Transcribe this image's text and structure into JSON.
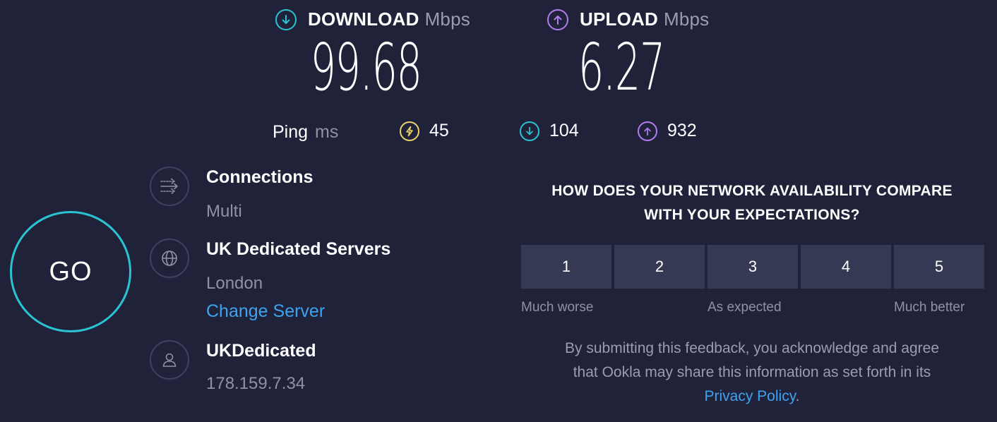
{
  "download": {
    "label": "DOWNLOAD",
    "unit": "Mbps",
    "value": "99.68",
    "icon": "arrow-down-circle-icon",
    "color": "#2ac3d1"
  },
  "upload": {
    "label": "UPLOAD",
    "unit": "Mbps",
    "value": "6.27",
    "icon": "arrow-up-circle-icon",
    "color": "#b27bf0"
  },
  "ping": {
    "label": "Ping",
    "unit": "ms",
    "idle": {
      "value": "45",
      "icon": "lightning-circle-icon",
      "color": "#e8d46a"
    },
    "download": {
      "value": "104",
      "icon": "arrow-down-circle-icon",
      "color": "#2ac3d1"
    },
    "upload": {
      "value": "932",
      "icon": "arrow-up-circle-icon",
      "color": "#b27bf0"
    }
  },
  "go_label": "GO",
  "connections": {
    "title": "Connections",
    "value": "Multi",
    "icon": "connections-icon"
  },
  "server": {
    "title": "UK Dedicated Servers",
    "location": "London",
    "change_label": "Change Server",
    "icon": "globe-icon"
  },
  "provider": {
    "title": "UKDedicated",
    "ip": "178.159.7.34",
    "icon": "user-icon"
  },
  "feedback": {
    "question_line1": "HOW DOES YOUR NETWORK AVAILABILITY COMPARE",
    "question_line2": "WITH YOUR EXPECTATIONS?",
    "ratings": [
      "1",
      "2",
      "3",
      "4",
      "5"
    ],
    "caption_low": "Much worse",
    "caption_mid": "As expected",
    "caption_high": "Much better",
    "note_line1": "By submitting this feedback, you acknowledge and agree",
    "note_line2": "that Ookla may share this information as set forth in its",
    "privacy_link": "Privacy Policy",
    "note_end": "."
  }
}
